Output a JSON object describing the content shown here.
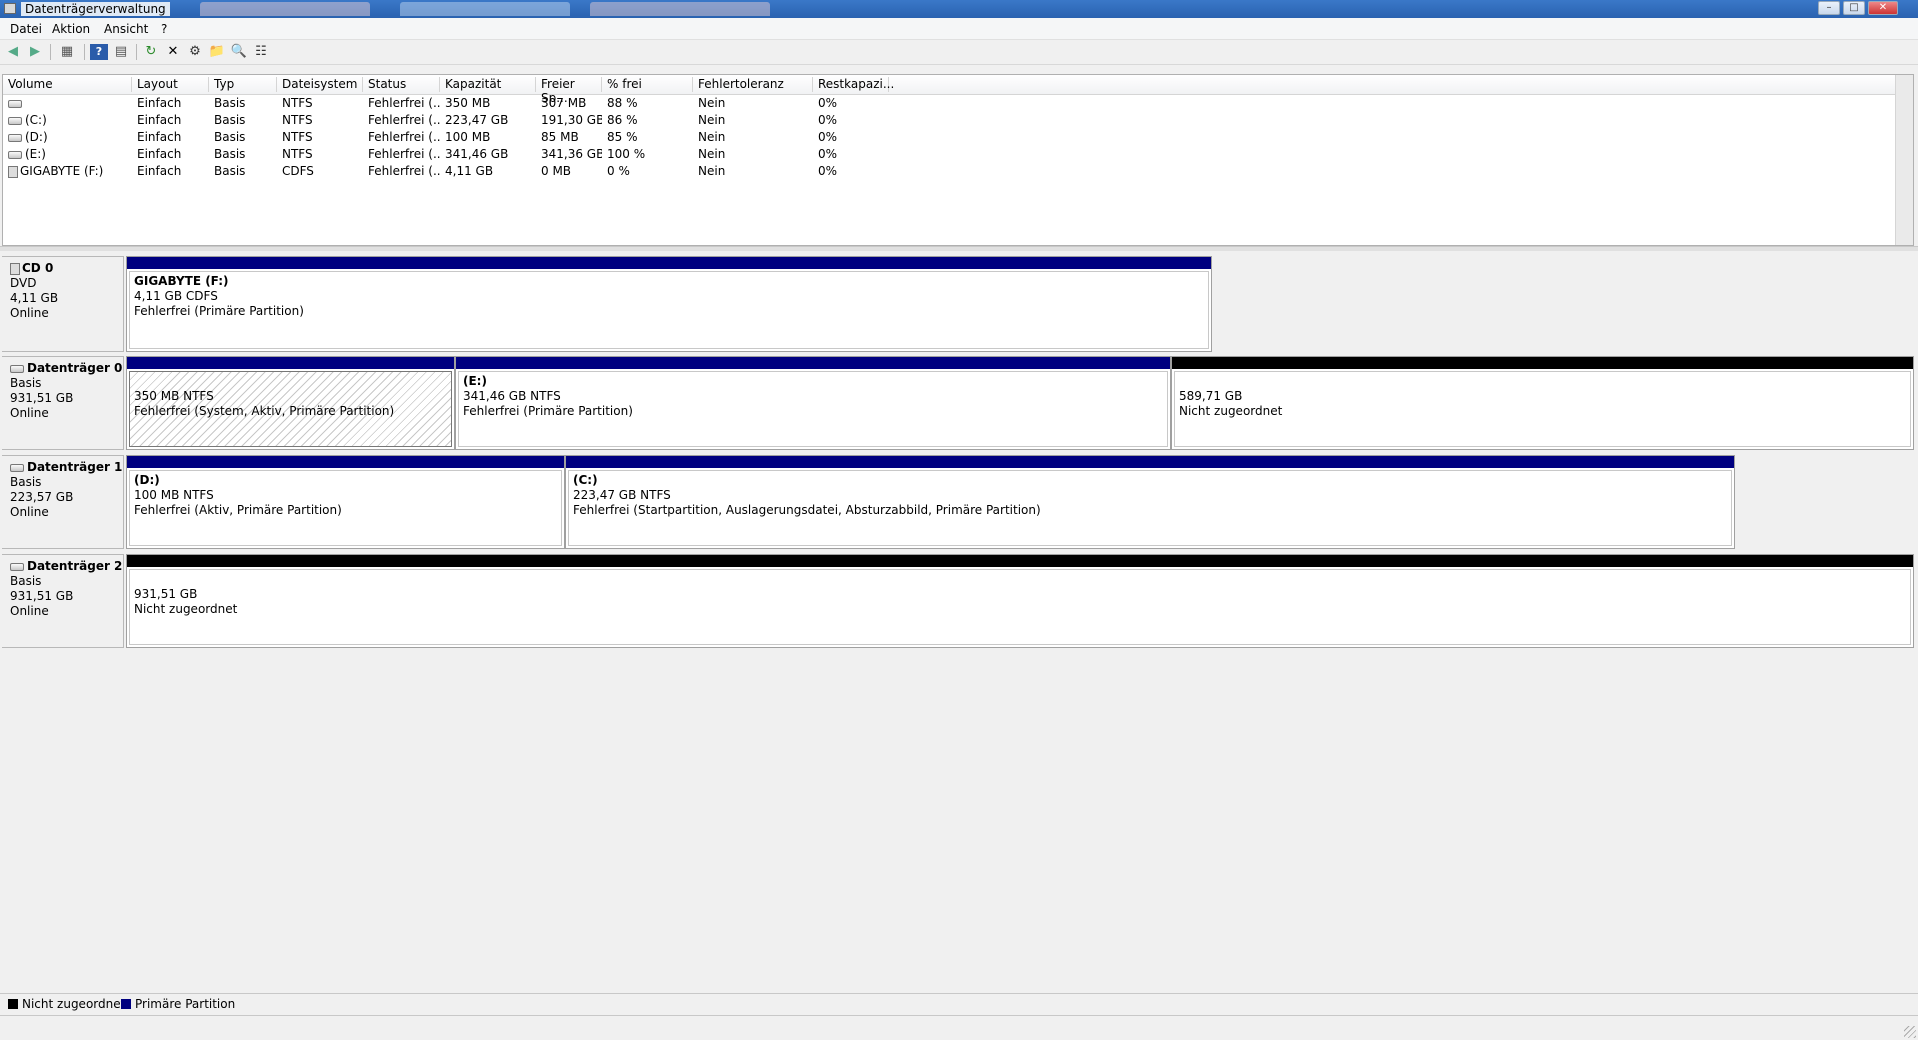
{
  "window": {
    "title": "Datenträgerverwaltung"
  },
  "menu": [
    "Datei",
    "Aktion",
    "Ansicht",
    "?"
  ],
  "toolbar": {
    "icons": [
      "back-icon",
      "forward-icon",
      "console-tree-icon",
      "help-icon",
      "properties-icon",
      "rescan-icon",
      "delete-icon",
      "settings-icon",
      "open-icon",
      "search-icon",
      "extra-icon"
    ]
  },
  "volume_list": {
    "columns": [
      "Volume",
      "Layout",
      "Typ",
      "Dateisystem",
      "Status",
      "Kapazität",
      "Freier Sp...",
      "% frei",
      "Fehlertoleranz",
      "Restkapazi..."
    ],
    "rows": [
      [
        "",
        "Einfach",
        "Basis",
        "NTFS",
        "Fehlerfrei (...",
        "350 MB",
        "307 MB",
        "88 %",
        "Nein",
        "0%"
      ],
      [
        "(C:)",
        "Einfach",
        "Basis",
        "NTFS",
        "Fehlerfrei (...",
        "223,47 GB",
        "191,30 GB",
        "86 %",
        "Nein",
        "0%"
      ],
      [
        "(D:)",
        "Einfach",
        "Basis",
        "NTFS",
        "Fehlerfrei (...",
        "100 MB",
        "85 MB",
        "85 %",
        "Nein",
        "0%"
      ],
      [
        "(E:)",
        "Einfach",
        "Basis",
        "NTFS",
        "Fehlerfrei (...",
        "341,46 GB",
        "341,36 GB",
        "100 %",
        "Nein",
        "0%"
      ],
      [
        "GIGABYTE (F:)",
        "Einfach",
        "Basis",
        "CDFS",
        "Fehlerfrei (...",
        "4,11 GB",
        "0 MB",
        "0 %",
        "Nein",
        "0%"
      ]
    ]
  },
  "disks": [
    {
      "name": "CD 0",
      "type": "DVD",
      "size": "4,11 GB",
      "state": "Online",
      "partitions": [
        {
          "label": "GIGABYTE  (F:)",
          "size": "4,11 GB CDFS",
          "status": "Fehlerfrei (Primäre Partition)"
        }
      ]
    },
    {
      "name": "Datenträger 0",
      "type": "Basis",
      "size": "931,51 GB",
      "state": "Online",
      "partitions": [
        {
          "label": "",
          "size": "350 MB NTFS",
          "status": "Fehlerfrei (System, Aktiv, Primäre Partition)"
        },
        {
          "label": "(E:)",
          "size": "341,46 GB NTFS",
          "status": "Fehlerfrei (Primäre Partition)"
        },
        {
          "label": "",
          "size": "589,71 GB",
          "status": "Nicht zugeordnet"
        }
      ]
    },
    {
      "name": "Datenträger 1",
      "type": "Basis",
      "size": "223,57 GB",
      "state": "Online",
      "partitions": [
        {
          "label": "(D:)",
          "size": "100 MB NTFS",
          "status": "Fehlerfrei (Aktiv, Primäre Partition)"
        },
        {
          "label": "(C:)",
          "size": "223,47 GB NTFS",
          "status": "Fehlerfrei (Startpartition, Auslagerungsdatei, Absturzabbild, Primäre Partition)"
        }
      ]
    },
    {
      "name": "Datenträger 2",
      "type": "Basis",
      "size": "931,51 GB",
      "state": "Online",
      "partitions": [
        {
          "label": "",
          "size": "931,51 GB",
          "status": "Nicht zugeordnet"
        }
      ]
    }
  ],
  "legend": {
    "unallocated": {
      "label": "Nicht zugeordnet",
      "color": "#000000"
    },
    "primary": {
      "label": "Primäre Partition",
      "color": "#000080"
    }
  },
  "colors": {
    "primary": "#000080",
    "unallocated": "#000000",
    "titlebar": "#2a62b0"
  }
}
